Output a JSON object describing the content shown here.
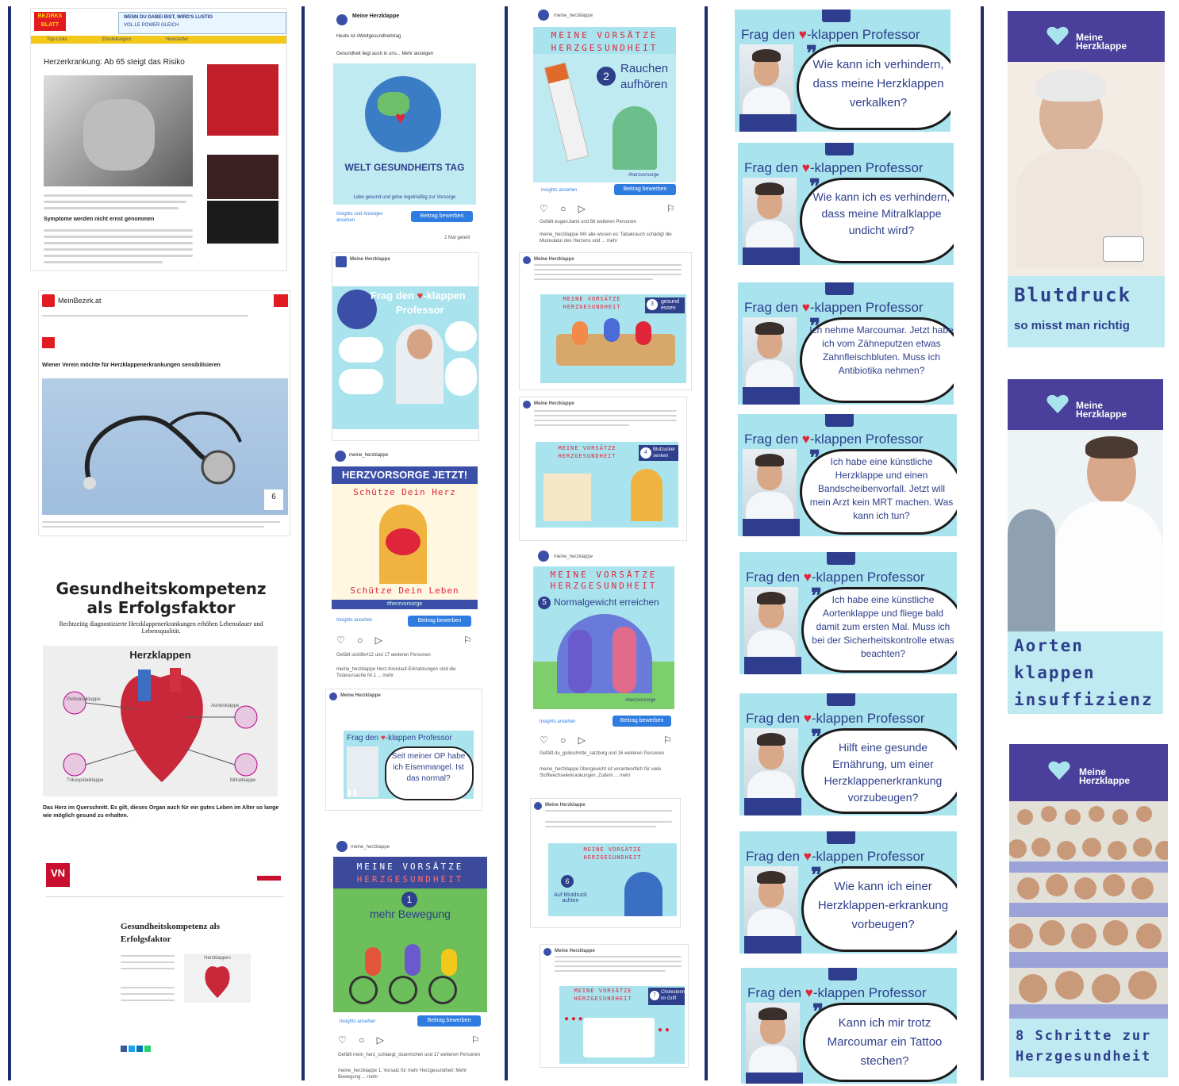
{
  "col1": {
    "bezirksblatt": {
      "masthead": "BEZIRKS BLATT",
      "nav": [
        "Top-Links",
        "Einstellungen",
        "Newsletter"
      ],
      "headline": "Herzerkrankung: Ab 65 steigt das Risiko",
      "subhead": "Symptome werden nicht ernst genommen",
      "ad_title": "WENN DU DABEI BIST, WIRD'S LUSTIG",
      "ad_subtitle": "VOL.LE POWER GLEICH"
    },
    "meinbezirk": {
      "logo": "MeinBezirk.at",
      "headline": "Wiener Verein möchte für Herzklappenerkrankungen sensibilisieren",
      "counter": "6"
    },
    "kompetenz": {
      "title_line1": "Gesundheitskompetenz",
      "title_line2": "als Erfolgsfaktor",
      "subtitle": "Rechtzeitig diagnostizierte Herzklappenerkrankungen erhöhen Lebensdauer und Lebensqualität.",
      "diagram_title": "Herzklappen",
      "labels": [
        "Pulmonalklappe",
        "Aortenklappe",
        "Trikuspidalklappe",
        "Mitralklappe"
      ],
      "caption": "Das Herz im Querschnitt. Es gilt, dieses Organ auch für ein gutes Leben im Alter so lange wie möglich gesund zu erhalten."
    },
    "vn": {
      "logo": "VN",
      "headline": "Gesundheitskompetenz als Erfolgsfaktor",
      "diagram_title": "Herzklappen"
    }
  },
  "col2": {
    "post1": {
      "account": "Meine Herzklappe",
      "text1": "Heute ist #Weltgesundheitstag",
      "text2": "Gesundheit liegt auch in uns... Mehr anzeigen",
      "image_title": "WELT GESUNDHEITS TAG",
      "image_sub": "Lebe gesund und gehe regelmäßig zur Vorsorge",
      "insights": "Insights und Anzeigen ansehen",
      "button": "Beitrag bewerben",
      "shares": "2 Mal geteilt"
    },
    "post2": {
      "account": "Meine Herzklappe",
      "image_title_a": "Frag den",
      "image_title_b": "-klappen",
      "image_title_c": "Professor"
    },
    "post3": {
      "account": "meine_herzklappe",
      "banner": "HERZVORSORGE JETZT!",
      "line1": "Schütze Dein Herz",
      "line2": "Schütze Dein Leben",
      "hashtag": "#herzvorsorge",
      "insights": "Insights ansehen",
      "button": "Beitrag bewerben",
      "likes": "Gefällt sicklife#12 und 17 weiteren Personen",
      "caption": "meine_herzklappe Herz-Kreislauf-Erkrankungen sind die Todesursache Nr.1 ... mehr"
    },
    "post4": {
      "account": "Meine Herzklappe",
      "title_a": "Frag den",
      "title_b": "-klappen Professor",
      "bubble": "Seit meiner OP habe ich Eisenmangel. Ist das normal?"
    },
    "post5": {
      "account": "meine_herzklappe",
      "banner1": "MEINE VORSÄTZE",
      "banner2": "HERZGESUNDHEIT",
      "number": "1",
      "title": "mehr Bewegung",
      "insights": "Insights ansehen",
      "button": "Beitrag bewerben",
      "likes": "Gefällt mein_herz_schlaegt_stuermchen und 17 weiteren Personen",
      "caption": "meine_herzklappe 1. Vorsatz für mehr Herzgesundheit: Mehr Bewegung ... mehr"
    }
  },
  "col3": {
    "post1": {
      "account": "meine_herzklappe",
      "banner1": "MEINE VORSÄTZE",
      "banner2": "HERZGESUNDHEIT",
      "number": "2",
      "title_l1": "Rauchen",
      "title_l2": "aufhören",
      "hashtag": "#herzvorsorge",
      "insights": "Insights ansehen",
      "button": "Beitrag bewerben",
      "likes": "Gefällt eugen.bami und 56 weiteren Personen",
      "caption": "meine_herzklappe Wir alle wissen es: Tabakrauch schädigt die Muskulatur des Herzens und ... mehr"
    },
    "post2": {
      "account": "Meine Herzklappe",
      "banner1": "MEINE VORSÄTZE",
      "banner2": "HERZGESUNDHEIT",
      "number": "3",
      "title": "gesund essen"
    },
    "post3": {
      "account": "Meine Herzklappe",
      "banner1": "MEINE VORSÄTZE",
      "banner2": "HERZGESUNDHEIT",
      "number": "4",
      "title": "Blutzucker senken"
    },
    "post4": {
      "account": "meine_herzklappe",
      "banner1": "MEINE VORSÄTZE",
      "banner2": "HERZGESUNDHEIT",
      "number": "5",
      "title": "Normalgewicht erreichen",
      "hashtag": "#herzvorsorge",
      "insights": "Insights ansehen",
      "button": "Beitrag bewerben",
      "likes": "Gefällt du_gsibschritte_salzburg und 16 weiteren Personen",
      "caption": "meine_herzklappe Übergewicht ist verantwortlich für viele Stoffwechselerkrankungen. Zudem ... mehr"
    },
    "post5": {
      "account": "Meine Herzklappe",
      "banner1": "MEINE VORSÄTZE",
      "banner2": "HERZGESUNDHEIT",
      "number": "6",
      "title": "Auf Blutdruck achten"
    },
    "post6": {
      "account": "Meine Herzklappe",
      "banner1": "MEINE VORSÄTZE",
      "banner2": "HERZGESUNDHEIT",
      "number": "7",
      "title": "Cholesterin im Griff"
    }
  },
  "col4": {
    "title_a": "Frag den",
    "title_b": "-klappen Professor",
    "cards": [
      {
        "q": "Wie kann ich verhindern, dass meine Herzklappen verkalken?"
      },
      {
        "q": "Wie kann ich es verhindern, dass meine Mitralklappe undicht wird?"
      },
      {
        "q": "Ich nehme Marcoumar. Jetzt habe ich vom Zähneputzen etwas Zahnfleischbluten. Muss ich Antibiotika nehmen?"
      },
      {
        "q": "Ich habe eine künstliche Herzklappe und einen Bandscheibenvorfall. Jetzt will mein Arzt kein MRT machen. Was kann ich tun?"
      },
      {
        "q": "Ich habe eine künstliche Aortenklappe und fliege bald damit zum ersten Mal. Muss ich bei der Sicherheitskontrolle etwas beachten?"
      },
      {
        "q": "Hilft eine gesunde Ernährung, um einer Herzklappenerkrankung vorzubeugen?"
      },
      {
        "q": "Wie kann ich einer Herzklappen-erkrankung vorbeugen?"
      },
      {
        "q": "Kann ich mir trotz Marcoumar ein Tattoo stechen?"
      }
    ]
  },
  "col5": {
    "brand_l1": "Meine",
    "brand_l2": "Herzklappe",
    "banner1": {
      "title": "Blutdruck",
      "subtitle": "so misst man richtig"
    },
    "banner2": {
      "l1": "Aorten",
      "l2": "klappen",
      "l3": "insuffizienz"
    },
    "banner3": {
      "l1": "8 Schritte zur",
      "l2": "Herzgesundheit"
    }
  },
  "colors": {
    "divider": "#1d2f6e",
    "teal": "#a9e4ee",
    "navy": "#2e3f8c",
    "purple": "#4a3f9a",
    "heart_red": "#e0253a",
    "button_blue": "#2f7ce0"
  }
}
